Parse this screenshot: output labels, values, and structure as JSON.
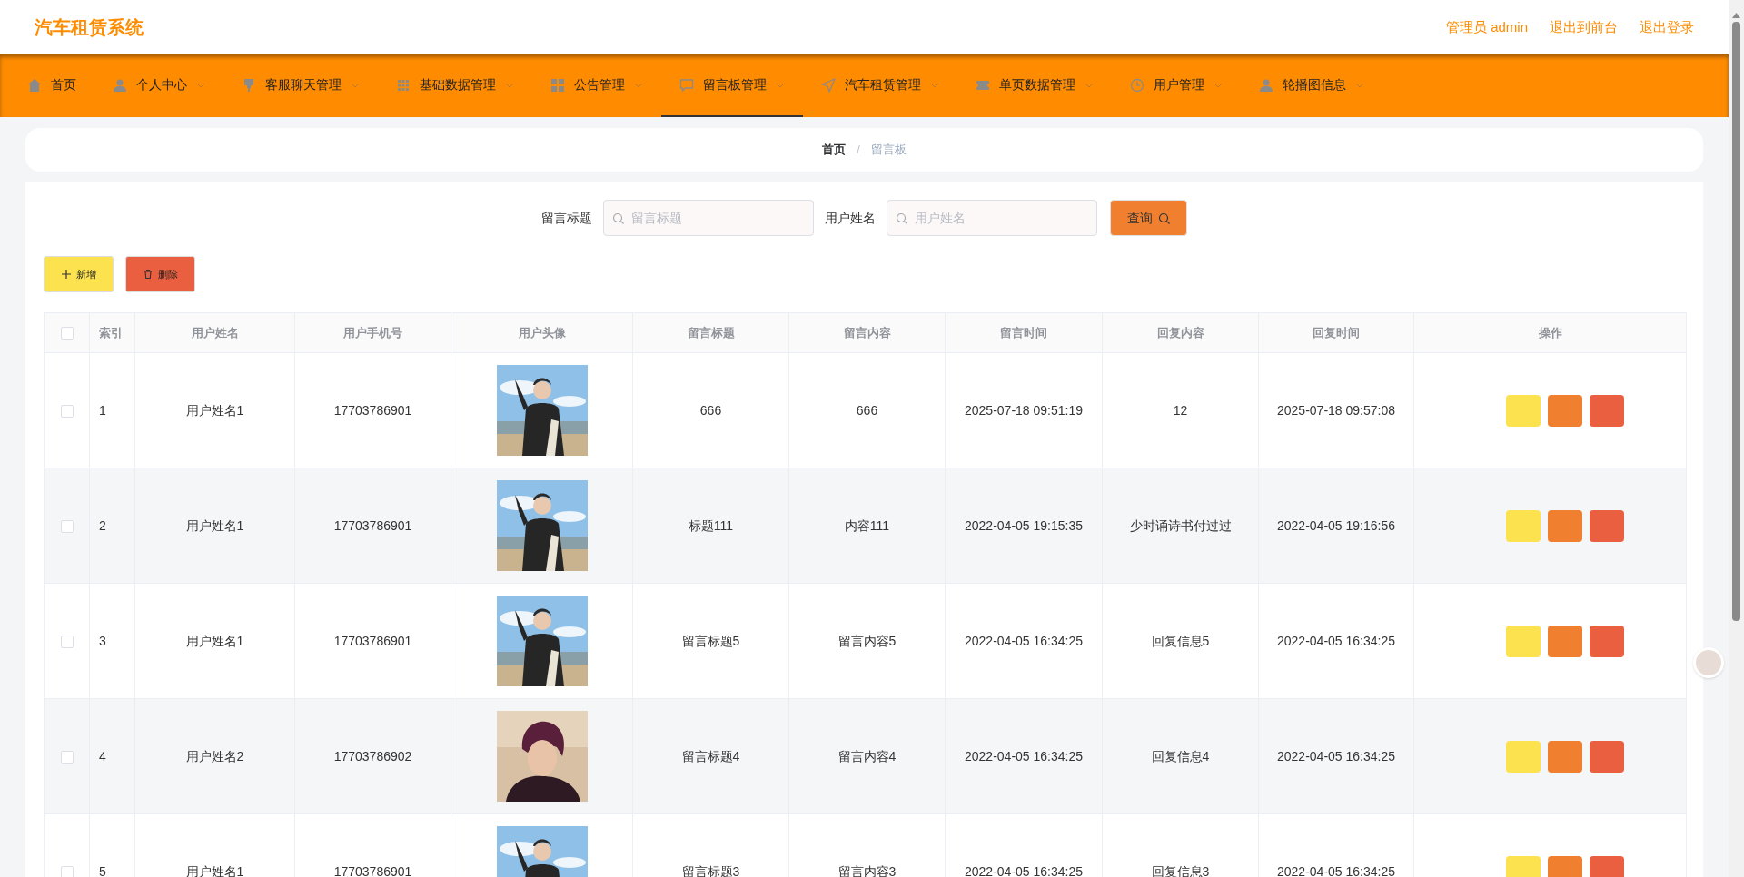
{
  "header": {
    "title": "汽车租赁系统",
    "links": [
      "管理员 admin",
      "退出到前台",
      "退出登录"
    ]
  },
  "nav": [
    {
      "label": "首页",
      "dropdown": false,
      "selected": false
    },
    {
      "label": "个人中心",
      "dropdown": true,
      "selected": false
    },
    {
      "label": "客服聊天管理",
      "dropdown": true,
      "selected": false
    },
    {
      "label": "基础数据管理",
      "dropdown": true,
      "selected": false
    },
    {
      "label": "公告管理",
      "dropdown": true,
      "selected": false
    },
    {
      "label": "留言板管理",
      "dropdown": true,
      "selected": true
    },
    {
      "label": "汽车租赁管理",
      "dropdown": true,
      "selected": false
    },
    {
      "label": "单页数据管理",
      "dropdown": true,
      "selected": false
    },
    {
      "label": "用户管理",
      "dropdown": true,
      "selected": false
    },
    {
      "label": "轮播图信息",
      "dropdown": true,
      "selected": false
    }
  ],
  "breadcrumb": {
    "items": [
      "首页",
      "留言板"
    ],
    "separator": "/"
  },
  "search": {
    "fields": [
      {
        "label": "留言标题",
        "placeholder": "留言标题"
      },
      {
        "label": "用户姓名",
        "placeholder": "用户姓名"
      }
    ],
    "button": "查询"
  },
  "actions": [
    {
      "kind": "add",
      "label": "新增"
    },
    {
      "kind": "delete",
      "label": "删除"
    }
  ],
  "table": {
    "select_all_checked": false,
    "columns": [
      "索引",
      "用户姓名",
      "用户手机号",
      "用户头像",
      "留言标题",
      "留言内容",
      "留言时间",
      "回复内容",
      "回复时间",
      "操作"
    ],
    "rows": [
      {
        "checked": false,
        "cells": [
          "1",
          "用户姓名1",
          "17703786901",
          "",
          "666",
          "666",
          "2025-07-18 09:51:19",
          "12",
          "2025-07-18 09:57:08"
        ]
      },
      {
        "checked": false,
        "cells": [
          "2",
          "用户姓名1",
          "17703786901",
          "",
          "标题111",
          "内容111",
          "2022-04-05 19:15:35",
          "少时诵诗书付过过",
          "2022-04-05 19:16:56"
        ]
      },
      {
        "checked": false,
        "cells": [
          "3",
          "用户姓名1",
          "17703786901",
          "",
          "留言标题5",
          "留言内容5",
          "2022-04-05 16:34:25",
          "回复信息5",
          "2022-04-05 16:34:25"
        ]
      },
      {
        "checked": false,
        "cells": [
          "4",
          "用户姓名2",
          "17703786902",
          "",
          "留言标题4",
          "留言内容4",
          "2022-04-05 16:34:25",
          "回复信息4",
          "2022-04-05 16:34:25"
        ]
      },
      {
        "checked": false,
        "cells": [
          "5",
          "用户姓名1",
          "17703786901",
          "",
          "留言标题3",
          "留言内容3",
          "2022-04-05 16:34:25",
          "回复信息3",
          "2022-04-05 16:34:25"
        ]
      }
    ]
  }
}
